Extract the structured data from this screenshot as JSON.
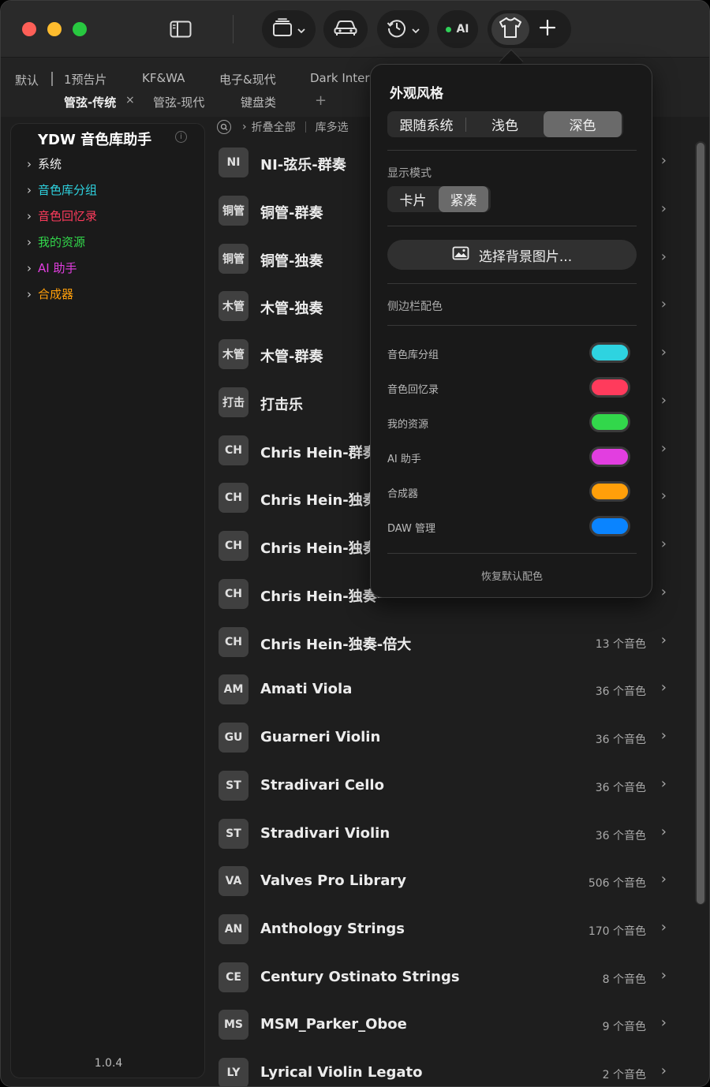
{
  "toolbar": {
    "ai_label": "AI",
    "ai_status_color": "#2fd158",
    "icons": [
      "sidebar-toggle-icon",
      "stack-icon",
      "car-icon",
      "history-icon",
      "shirt-icon",
      "plus-icon"
    ]
  },
  "tabs": {
    "row1": [
      "默认",
      "1预告片",
      "KF&WA",
      "电子&现代",
      "Dark Interv"
    ],
    "row2": [
      "管弦-传统",
      "管弦-现代",
      "键盘类"
    ],
    "close": "×",
    "add": "+"
  },
  "sidebar": {
    "title": "YDW 音色库助手",
    "info": "i",
    "items": [
      {
        "label": "系统",
        "color": "#f0f0f0"
      },
      {
        "label": "音色库分组",
        "color": "#2ed3e0"
      },
      {
        "label": "音色回忆录",
        "color": "#ff3b5c"
      },
      {
        "label": "我的资源",
        "color": "#32d74b"
      },
      {
        "label": "AI 助手",
        "color": "#e23ee0"
      },
      {
        "label": "合成器",
        "color": "#ff9f0a"
      }
    ],
    "version": "1.0.4"
  },
  "filterbar": {
    "collapse_all": "折叠全部",
    "multi_select": "库多选"
  },
  "libraries": [
    {
      "badge": "NI",
      "name": "NI-弦乐-群奏",
      "count": ""
    },
    {
      "badge": "铜管",
      "name": "铜管-群奏",
      "count": ""
    },
    {
      "badge": "铜管",
      "name": "铜管-独奏",
      "count": ""
    },
    {
      "badge": "木管",
      "name": "木管-独奏",
      "count": ""
    },
    {
      "badge": "木管",
      "name": "木管-群奏",
      "count": ""
    },
    {
      "badge": "打击",
      "name": "打击乐",
      "count": ""
    },
    {
      "badge": "CH",
      "name": "Chris Hein-群奏",
      "count": ""
    },
    {
      "badge": "CH",
      "name": "Chris Hein-独奏-",
      "count": ""
    },
    {
      "badge": "CH",
      "name": "Chris Hein-独奏-",
      "count": ""
    },
    {
      "badge": "CH",
      "name": "Chris Hein-独奏-",
      "count": ""
    },
    {
      "badge": "CH",
      "name": "Chris Hein-独奏-倍大",
      "count": "13 个音色"
    },
    {
      "badge": "AM",
      "name": "Amati Viola",
      "count": "36 个音色"
    },
    {
      "badge": "GU",
      "name": "Guarneri Violin",
      "count": "36 个音色"
    },
    {
      "badge": "ST",
      "name": "Stradivari Cello",
      "count": "36 个音色"
    },
    {
      "badge": "ST",
      "name": "Stradivari Violin",
      "count": "36 个音色"
    },
    {
      "badge": "VA",
      "name": "Valves Pro Library",
      "count": "506 个音色"
    },
    {
      "badge": "AN",
      "name": "Anthology Strings",
      "count": "170 个音色"
    },
    {
      "badge": "CE",
      "name": "Century Ostinato Strings",
      "count": "8 个音色"
    },
    {
      "badge": "MS",
      "name": "MSM_Parker_Oboe",
      "count": "9 个音色"
    },
    {
      "badge": "LY",
      "name": "Lyrical Violin Legato",
      "count": "2 个音色"
    }
  ],
  "popover": {
    "title": "外观风格",
    "theme_options": [
      "跟随系统",
      "浅色",
      "深色"
    ],
    "theme_selected": "深色",
    "display_mode_label": "显示模式",
    "display_options": [
      "卡片",
      "紧凑"
    ],
    "display_selected": "紧凑",
    "background_button": "选择背景图片...",
    "sidebar_colors_label": "侧边栏配色",
    "colors": [
      {
        "label": "音色库分组",
        "color": "#2ed3e0"
      },
      {
        "label": "音色回忆录",
        "color": "#ff3b5c"
      },
      {
        "label": "我的资源",
        "color": "#32d74b"
      },
      {
        "label": "AI 助手",
        "color": "#e23ee0"
      },
      {
        "label": "合成器",
        "color": "#ff9f0a"
      },
      {
        "label": "DAW 管理",
        "color": "#0a84ff"
      }
    ],
    "reset": "恢复默认配色"
  }
}
